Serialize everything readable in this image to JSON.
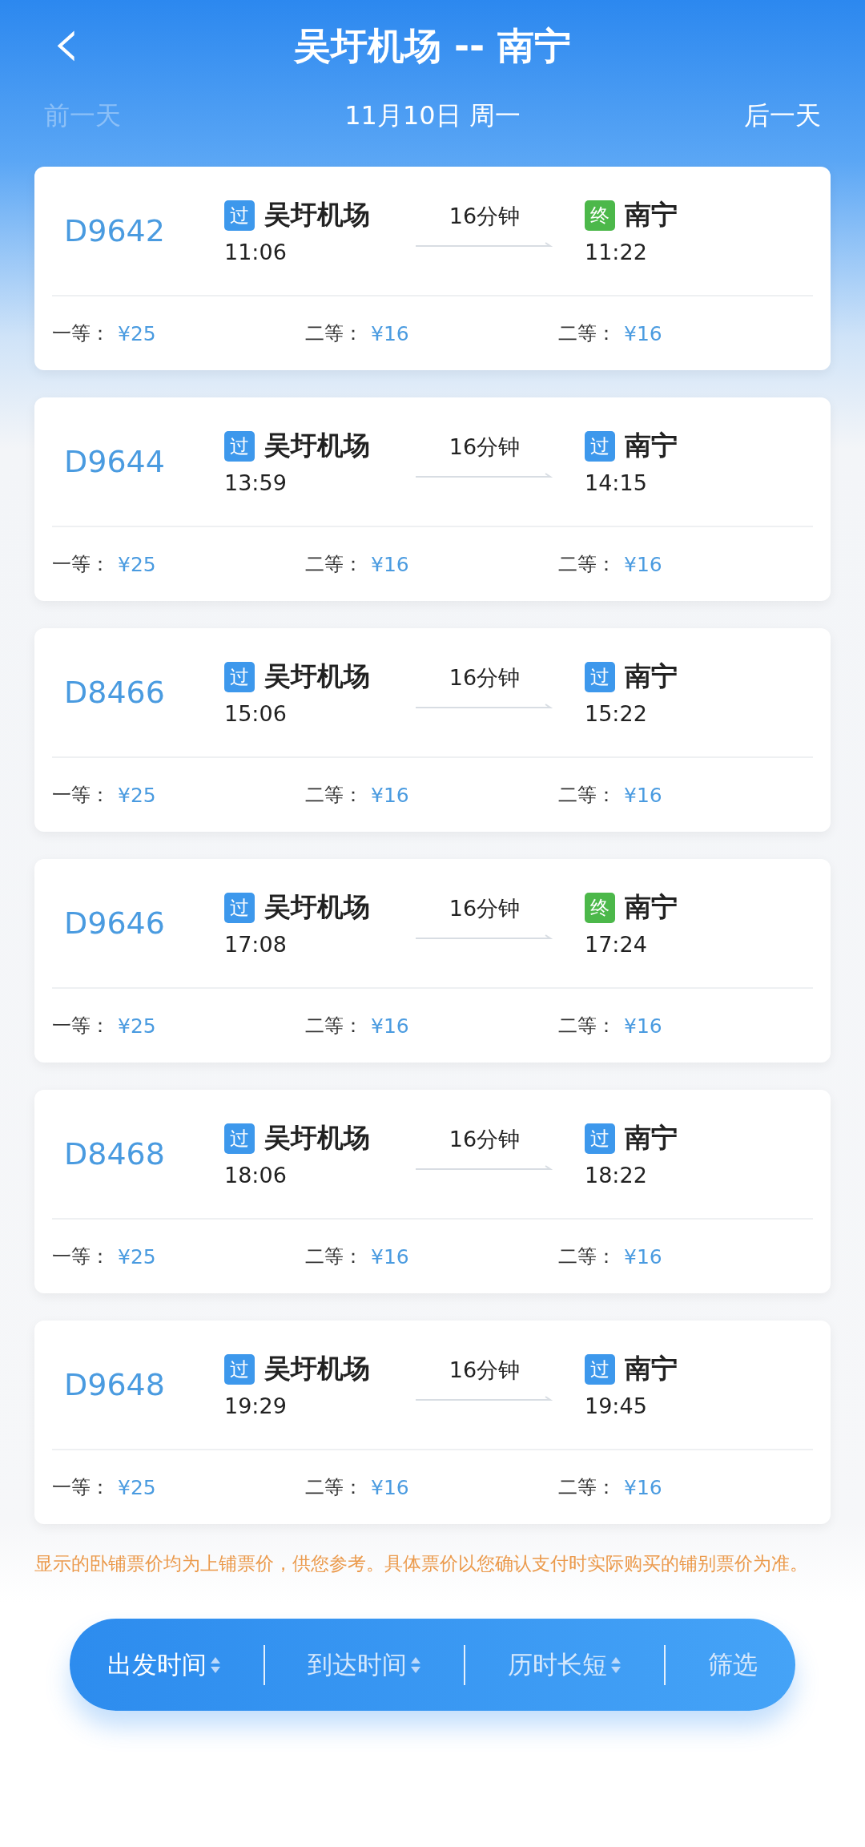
{
  "header": {
    "back_icon": "‹",
    "title": "吴圩机场 -- 南宁",
    "prev_day": {
      "label": "前一天",
      "disabled": true
    },
    "date": "11月10日 周一",
    "next_day": {
      "label": "后一天",
      "disabled": false
    }
  },
  "trains": [
    {
      "number": "D9642",
      "from": {
        "tag": "过",
        "kind": "pass",
        "station": "吴圩机场",
        "time": "11:06"
      },
      "duration": "16分钟",
      "to": {
        "tag": "终",
        "kind": "end",
        "station": "南宁",
        "time": "11:22"
      },
      "prices": [
        {
          "seat": "一等：",
          "price": "¥25"
        },
        {
          "seat": "二等：",
          "price": "¥16"
        },
        {
          "seat": "二等：",
          "price": "¥16"
        }
      ]
    },
    {
      "number": "D9644",
      "from": {
        "tag": "过",
        "kind": "pass",
        "station": "吴圩机场",
        "time": "13:59"
      },
      "duration": "16分钟",
      "to": {
        "tag": "过",
        "kind": "pass",
        "station": "南宁",
        "time": "14:15"
      },
      "prices": [
        {
          "seat": "一等：",
          "price": "¥25"
        },
        {
          "seat": "二等：",
          "price": "¥16"
        },
        {
          "seat": "二等：",
          "price": "¥16"
        }
      ]
    },
    {
      "number": "D8466",
      "from": {
        "tag": "过",
        "kind": "pass",
        "station": "吴圩机场",
        "time": "15:06"
      },
      "duration": "16分钟",
      "to": {
        "tag": "过",
        "kind": "pass",
        "station": "南宁",
        "time": "15:22"
      },
      "prices": [
        {
          "seat": "一等：",
          "price": "¥25"
        },
        {
          "seat": "二等：",
          "price": "¥16"
        },
        {
          "seat": "二等：",
          "price": "¥16"
        }
      ]
    },
    {
      "number": "D9646",
      "from": {
        "tag": "过",
        "kind": "pass",
        "station": "吴圩机场",
        "time": "17:08"
      },
      "duration": "16分钟",
      "to": {
        "tag": "终",
        "kind": "end",
        "station": "南宁",
        "time": "17:24"
      },
      "prices": [
        {
          "seat": "一等：",
          "price": "¥25"
        },
        {
          "seat": "二等：",
          "price": "¥16"
        },
        {
          "seat": "二等：",
          "price": "¥16"
        }
      ]
    },
    {
      "number": "D8468",
      "from": {
        "tag": "过",
        "kind": "pass",
        "station": "吴圩机场",
        "time": "18:06"
      },
      "duration": "16分钟",
      "to": {
        "tag": "过",
        "kind": "pass",
        "station": "南宁",
        "time": "18:22"
      },
      "prices": [
        {
          "seat": "一等：",
          "price": "¥25"
        },
        {
          "seat": "二等：",
          "price": "¥16"
        },
        {
          "seat": "二等：",
          "price": "¥16"
        }
      ]
    },
    {
      "number": "D9648",
      "from": {
        "tag": "过",
        "kind": "pass",
        "station": "吴圩机场",
        "time": "19:29"
      },
      "duration": "16分钟",
      "to": {
        "tag": "过",
        "kind": "pass",
        "station": "南宁",
        "time": "19:45"
      },
      "prices": [
        {
          "seat": "一等：",
          "price": "¥25"
        },
        {
          "seat": "二等：",
          "price": "¥16"
        },
        {
          "seat": "二等：",
          "price": "¥16"
        }
      ]
    }
  ],
  "note": "显示的卧铺票价均为上铺票价，供您参考。具体票价以您确认支付时实际购买的铺别票价为准。",
  "sort_bar": [
    {
      "label": "出发时间",
      "kind": "sort",
      "selected": true
    },
    {
      "label": "到达时间",
      "kind": "sort",
      "selected": false
    },
    {
      "label": "历时长短",
      "kind": "sort",
      "selected": false
    },
    {
      "label": "筛选",
      "kind": "filter",
      "selected": false
    }
  ]
}
